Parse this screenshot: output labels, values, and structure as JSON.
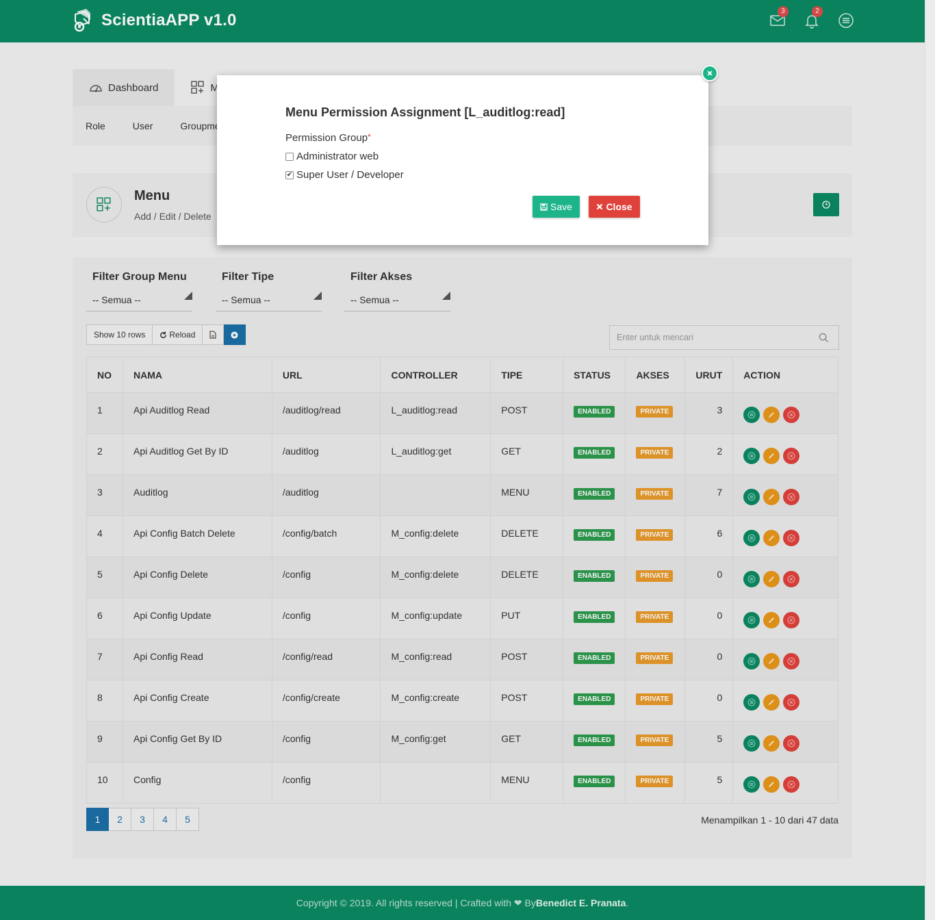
{
  "app": {
    "title": "ScientiaAPP v1.0"
  },
  "topbar": {
    "mail_count": "3",
    "notif_count": "2"
  },
  "tabs": [
    {
      "label": "Dashboard"
    },
    {
      "label": "M"
    }
  ],
  "subnav": [
    "Role",
    "User",
    "Groupme"
  ],
  "page_header": {
    "title": "Menu",
    "subtitle": "Add / Edit / Delete"
  },
  "filters": [
    {
      "label": "Filter Group Menu",
      "value": "-- Semua --"
    },
    {
      "label": "Filter Tipe",
      "value": "-- Semua --"
    },
    {
      "label": "Filter Akses",
      "value": "-- Semua --"
    }
  ],
  "toolbar": {
    "show_rows": "Show 10 rows",
    "reload": "Reload"
  },
  "search": {
    "placeholder": "Enter untuk mencari"
  },
  "table": {
    "columns": [
      "NO",
      "NAMA",
      "URL",
      "CONTROLLER",
      "TIPE",
      "STATUS",
      "AKSES",
      "URUT",
      "ACTION"
    ],
    "rows": [
      {
        "no": "1",
        "nama": "Api Auditlog Read",
        "url": "/auditlog/read",
        "controller": "L_auditlog:read",
        "tipe": "POST",
        "status": "ENABLED",
        "akses": "PRIVATE",
        "urut": "3"
      },
      {
        "no": "2",
        "nama": "Api Auditlog Get By ID",
        "url": "/auditlog",
        "controller": "L_auditlog:get",
        "tipe": "GET",
        "status": "ENABLED",
        "akses": "PRIVATE",
        "urut": "2"
      },
      {
        "no": "3",
        "nama": "Auditlog",
        "url": "/auditlog",
        "controller": "",
        "tipe": "MENU",
        "status": "ENABLED",
        "akses": "PRIVATE",
        "urut": "7"
      },
      {
        "no": "4",
        "nama": "Api Config Batch Delete",
        "url": "/config/batch",
        "controller": "M_config:delete",
        "tipe": "DELETE",
        "status": "ENABLED",
        "akses": "PRIVATE",
        "urut": "6"
      },
      {
        "no": "5",
        "nama": "Api Config Delete",
        "url": "/config",
        "controller": "M_config:delete",
        "tipe": "DELETE",
        "status": "ENABLED",
        "akses": "PRIVATE",
        "urut": "0"
      },
      {
        "no": "6",
        "nama": "Api Config Update",
        "url": "/config",
        "controller": "M_config:update",
        "tipe": "PUT",
        "status": "ENABLED",
        "akses": "PRIVATE",
        "urut": "0"
      },
      {
        "no": "7",
        "nama": "Api Config Read",
        "url": "/config/read",
        "controller": "M_config:read",
        "tipe": "POST",
        "status": "ENABLED",
        "akses": "PRIVATE",
        "urut": "0"
      },
      {
        "no": "8",
        "nama": "Api Config Create",
        "url": "/config/create",
        "controller": "M_config:create",
        "tipe": "POST",
        "status": "ENABLED",
        "akses": "PRIVATE",
        "urut": "0"
      },
      {
        "no": "9",
        "nama": "Api Config Get By ID",
        "url": "/config",
        "controller": "M_config:get",
        "tipe": "GET",
        "status": "ENABLED",
        "akses": "PRIVATE",
        "urut": "5"
      },
      {
        "no": "10",
        "nama": "Config",
        "url": "/config",
        "controller": "",
        "tipe": "MENU",
        "status": "ENABLED",
        "akses": "PRIVATE",
        "urut": "5"
      }
    ]
  },
  "pagination": {
    "pages": [
      "1",
      "2",
      "3",
      "4",
      "5"
    ],
    "current": "1",
    "info": "Menampilkan 1 - 10 dari 47 data"
  },
  "footer": {
    "text": "Copyright © 2019. All rights reserved | Crafted with ❤ By ",
    "author": "Benedict E. Pranata",
    "end": "."
  },
  "modal": {
    "title": "Menu Permission Assignment [L_auditlog:read]",
    "group_label": "Permission Group",
    "required_mark": "*",
    "options": [
      {
        "label": "Administrator web",
        "checked": false
      },
      {
        "label": "Super User / Developer",
        "checked": true
      }
    ],
    "save_label": "Save",
    "close_label": "Close"
  },
  "colors": {
    "primary": "#0b8a63",
    "accent": "#1db48a",
    "danger": "#e0413b",
    "warning": "#e8971b",
    "link": "#1b6fa8"
  }
}
